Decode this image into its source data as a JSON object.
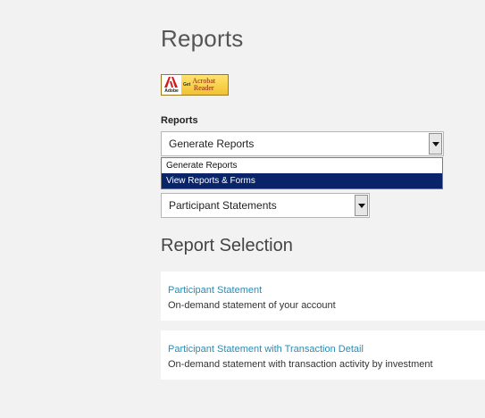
{
  "page": {
    "title": "Reports"
  },
  "acrobat": {
    "adobe_word": "Adobe",
    "get": "Get",
    "line1": "Acrobat",
    "line2": "Reader",
    "icon": "adobe-acrobat-icon"
  },
  "form": {
    "reports_label": "Reports",
    "reports_select": {
      "selected": "Generate Reports",
      "options": [
        "Generate Reports",
        "View Reports & Forms"
      ],
      "highlighted_index": 1
    },
    "report_type_select": {
      "selected": "Participant Statements"
    }
  },
  "report_selection": {
    "title": "Report Selection",
    "items": [
      {
        "link": "Participant Statement",
        "description": "On-demand statement of your account"
      },
      {
        "link": "Participant Statement with Transaction Detail",
        "description": "On-demand statement with transaction activity by investment"
      }
    ]
  },
  "colors": {
    "background": "#f2f2f2",
    "link": "#2a8bb5",
    "highlight": "#0a246a"
  }
}
